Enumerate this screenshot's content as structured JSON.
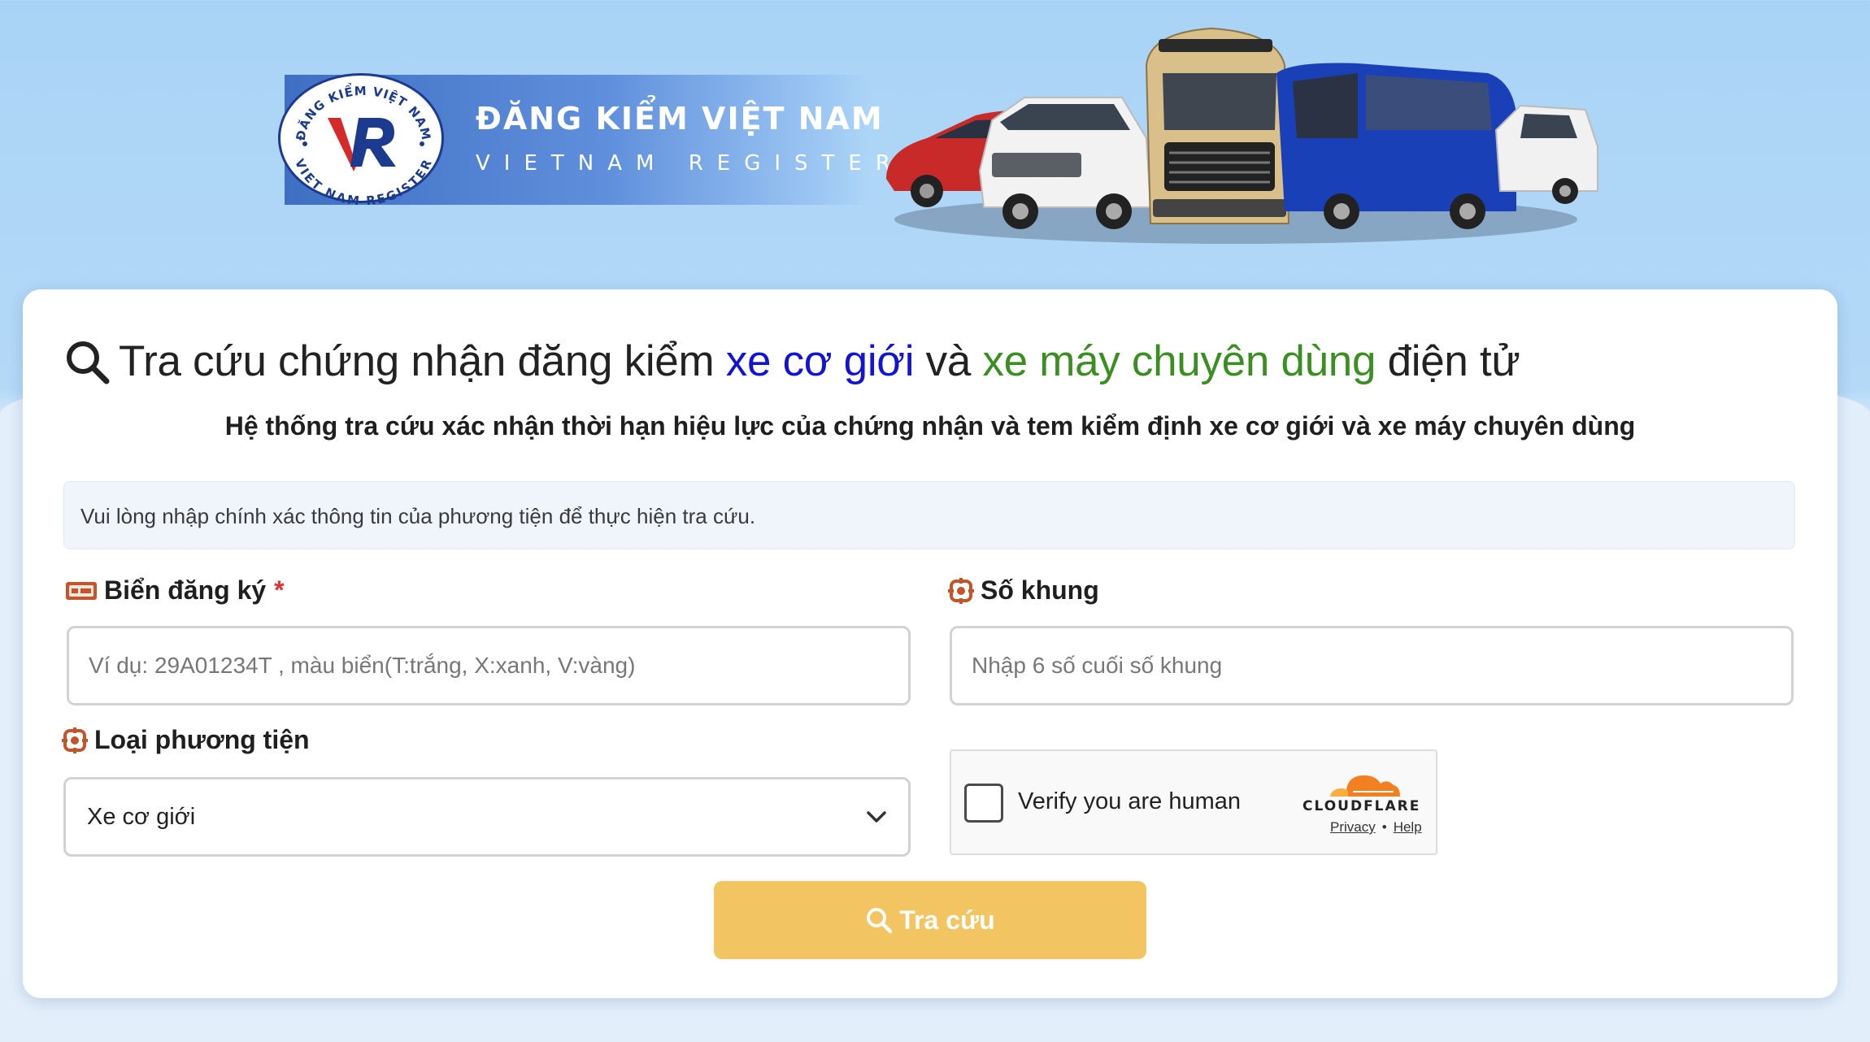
{
  "banner": {
    "brand_name": "ĐĂNG KIỂM VIỆT NAM",
    "brand_sub": "VIETNAM REGISTER",
    "logo_ring_top": "ĐĂNG KIỂM VIỆT NAM",
    "logo_ring_bottom": "VIET NAM REGISTER",
    "logo_letters": "VR"
  },
  "title": {
    "part1": "Tra cứu chứng nhận đăng kiểm ",
    "highlight_blue": "xe cơ giới",
    "part2": " và ",
    "highlight_green": "xe máy chuyên dùng",
    "part3": " điện tử"
  },
  "subtitle": "Hệ thống tra cứu xác nhận thời hạn hiệu lực của chứng nhận và tem kiểm định xe cơ giới và xe máy chuyên dùng",
  "notice": "Vui lòng nhập chính xác thông tin của phương tiện để thực hiện tra cứu.",
  "form": {
    "plate_label": "Biển đăng ký",
    "plate_required": "*",
    "plate_placeholder": "Ví dụ: 29A01234T , màu biển(T:trắng, X:xanh, V:vàng)",
    "plate_value": "",
    "frame_label": "Số khung",
    "frame_placeholder": "Nhập 6 số cuối số khung",
    "frame_value": "",
    "type_label": "Loại phương tiện",
    "type_selected": "Xe cơ giới",
    "submit_label": "Tra cứu"
  },
  "captcha": {
    "text": "Verify you are human",
    "brand": "CLOUDFLARE",
    "privacy": "Privacy",
    "separator": "•",
    "help": "Help",
    "checked": false
  },
  "colors": {
    "blue_highlight": "#1313d6",
    "green_highlight": "#3b8e22",
    "button": "#f3c462",
    "required": "#dd3333",
    "cloudflare_orange": "#f38020"
  }
}
